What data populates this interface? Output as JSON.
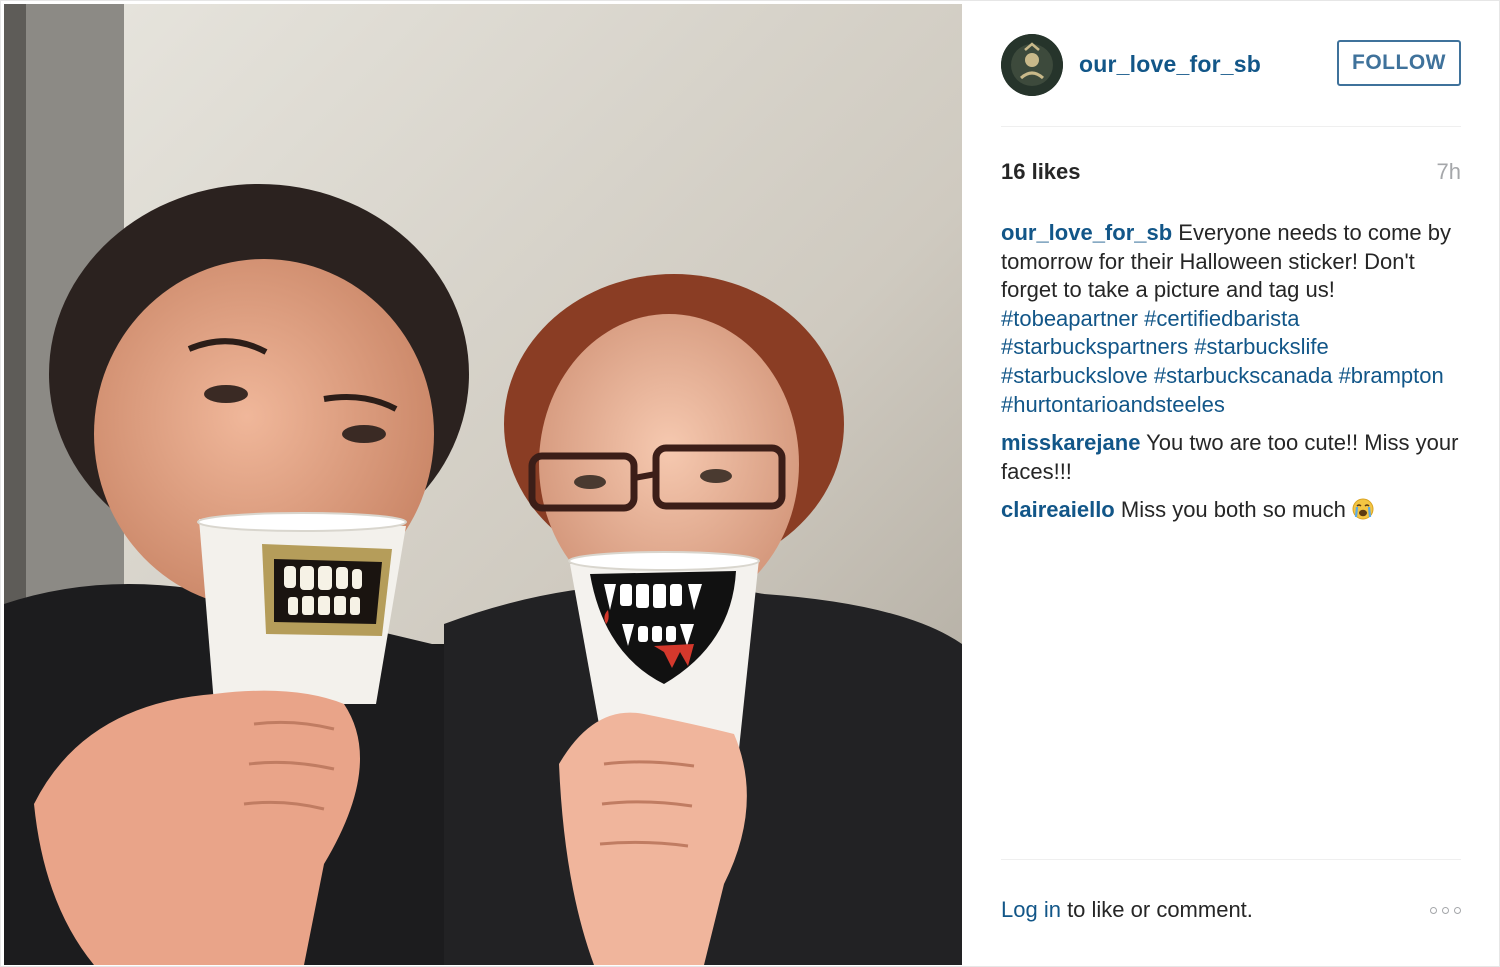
{
  "post": {
    "username": "our_love_for_sb",
    "follow_label": "FOLLOW",
    "likes": "16 likes",
    "time": "7h"
  },
  "caption": {
    "author": "our_love_for_sb",
    "text": "Everyone needs to come by tomorrow for their Halloween sticker! Don't forget to take a picture and tag us!",
    "hashtags": [
      "#tobeapartner",
      "#certifiedbarista",
      "#starbuckspartners",
      "#starbuckslife",
      "#starbuckslove",
      "#starbuckscanada",
      "#brampton",
      "#hurtontarioandsteeles"
    ]
  },
  "comments": [
    {
      "author": "misskarejane",
      "text": "You two are too cute!! Miss your faces!!!"
    },
    {
      "author": "claireaiello",
      "text": "Miss you both so much",
      "emoji": "crying-face-icon"
    }
  ],
  "footer": {
    "login_link": "Log in",
    "login_suffix": " to like or comment."
  },
  "colors": {
    "link": "#125688",
    "follow_border": "#3f729b",
    "muted": "#a5a7aa"
  }
}
